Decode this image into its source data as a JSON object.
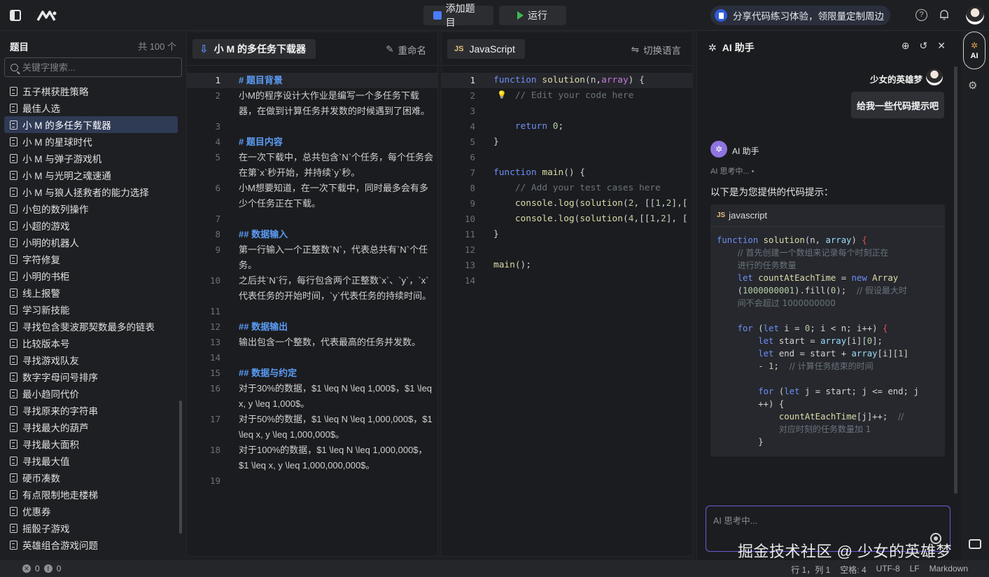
{
  "topbar": {
    "add_label": "添加题目",
    "run_label": "运行",
    "promo": "分享代码练习体验，领限量定制周边"
  },
  "sidebar": {
    "title": "题目",
    "count": "共 100 个",
    "search_placeholder": "关键字搜索...",
    "items": [
      "五子棋获胜策略",
      "最佳人选",
      "小 M 的多任务下载器",
      "小 M 的星球时代",
      "小 M 与弹子游戏机",
      "小 M 与光明之魂速通",
      "小 M 与狼人拯救者的能力选择",
      "小包的数列操作",
      "小超的游戏",
      "小明的机器人",
      "字符修复",
      "小明的书柜",
      "线上报警",
      "学习新技能",
      "寻找包含斐波那契数最多的链表",
      "比较版本号",
      "寻找游戏队友",
      "数字字母问号排序",
      "最小趋同代价",
      "寻找原来的字符串",
      "寻找最大的葫芦",
      "寻找最大面积",
      "寻找最大值",
      "硬币凑数",
      "有点限制地走楼梯",
      "优惠券",
      "摇骰子游戏",
      "英雄组合游戏问题"
    ],
    "active_index": 2
  },
  "md_panel": {
    "file_name": "小 M 的多任务下载器",
    "rename_label": "重命名",
    "lines": [
      {
        "n": "1",
        "t": "# 题目背景",
        "h": true
      },
      {
        "n": "2",
        "t": "小M的程序设计大作业是编写一个多任务下载器，在做到计算任务并发数的时候遇到了困难。"
      },
      {
        "n": "3",
        "t": ""
      },
      {
        "n": "4",
        "t": "# 题目内容",
        "h": true
      },
      {
        "n": "5",
        "t": "在一次下载中，总共包含`N`个任务，每个任务会在第`x`秒开始，并持续`y`秒。"
      },
      {
        "n": "6",
        "t": "小M想要知道，在一次下载中，同时最多会有多少个任务正在下载。"
      },
      {
        "n": "7",
        "t": ""
      },
      {
        "n": "8",
        "t": "## 数据输入",
        "h": true
      },
      {
        "n": "9",
        "t": "第一行输入一个正整数`N`，代表总共有`N`个任务。"
      },
      {
        "n": "10",
        "t": "之后共`N`行，每行包含两个正整数`x`、`y`，`x`代表任务的开始时间，`y`代表任务的持续时间。"
      },
      {
        "n": "11",
        "t": ""
      },
      {
        "n": "12",
        "t": "## 数据输出",
        "h": true
      },
      {
        "n": "13",
        "t": "输出包含一个整数，代表最高的任务并发数。"
      },
      {
        "n": "14",
        "t": ""
      },
      {
        "n": "15",
        "t": "## 数据与约定",
        "h": true
      },
      {
        "n": "16",
        "t": "对于30%的数据，$1 \\leq N \\leq 1,000$，$1 \\leq x, y \\leq 1,000$。"
      },
      {
        "n": "17",
        "t": "对于50%的数据，$1 \\leq N \\leq 1,000,000$，$1 \\leq x, y \\leq 1,000,000$。"
      },
      {
        "n": "18",
        "t": "对于100%的数据，$1 \\leq N \\leq 1,000,000$，$1 \\leq x, y \\leq 1,000,000,000$。"
      },
      {
        "n": "19",
        "t": ""
      }
    ]
  },
  "code_panel": {
    "language": "JavaScript",
    "switch_label": "切换语言",
    "line_numbers": [
      "1",
      "2",
      "3",
      "4",
      "5",
      "6",
      "7",
      "8",
      "9",
      "10",
      "11",
      "12",
      "13",
      "14"
    ]
  },
  "ai": {
    "title": "AI 助手",
    "user_name": "少女的英雄梦",
    "user_message": "给我一些代码提示吧",
    "assistant_name": "AI 助手",
    "thinking": "AI 思考中... •",
    "intro": "以下是为您提供的代码提示：",
    "code_lang": "javascript",
    "input_placeholder": "AI 思考中...",
    "rail_label": "AI"
  },
  "status": {
    "errors": "0",
    "warnings": "0",
    "position": "行 1，列 1",
    "spaces": "空格: 4",
    "encoding": "UTF-8",
    "eol": "LF",
    "mode": "Markdown"
  },
  "watermark": "掘金技术社区 @ 少女的英雄梦"
}
